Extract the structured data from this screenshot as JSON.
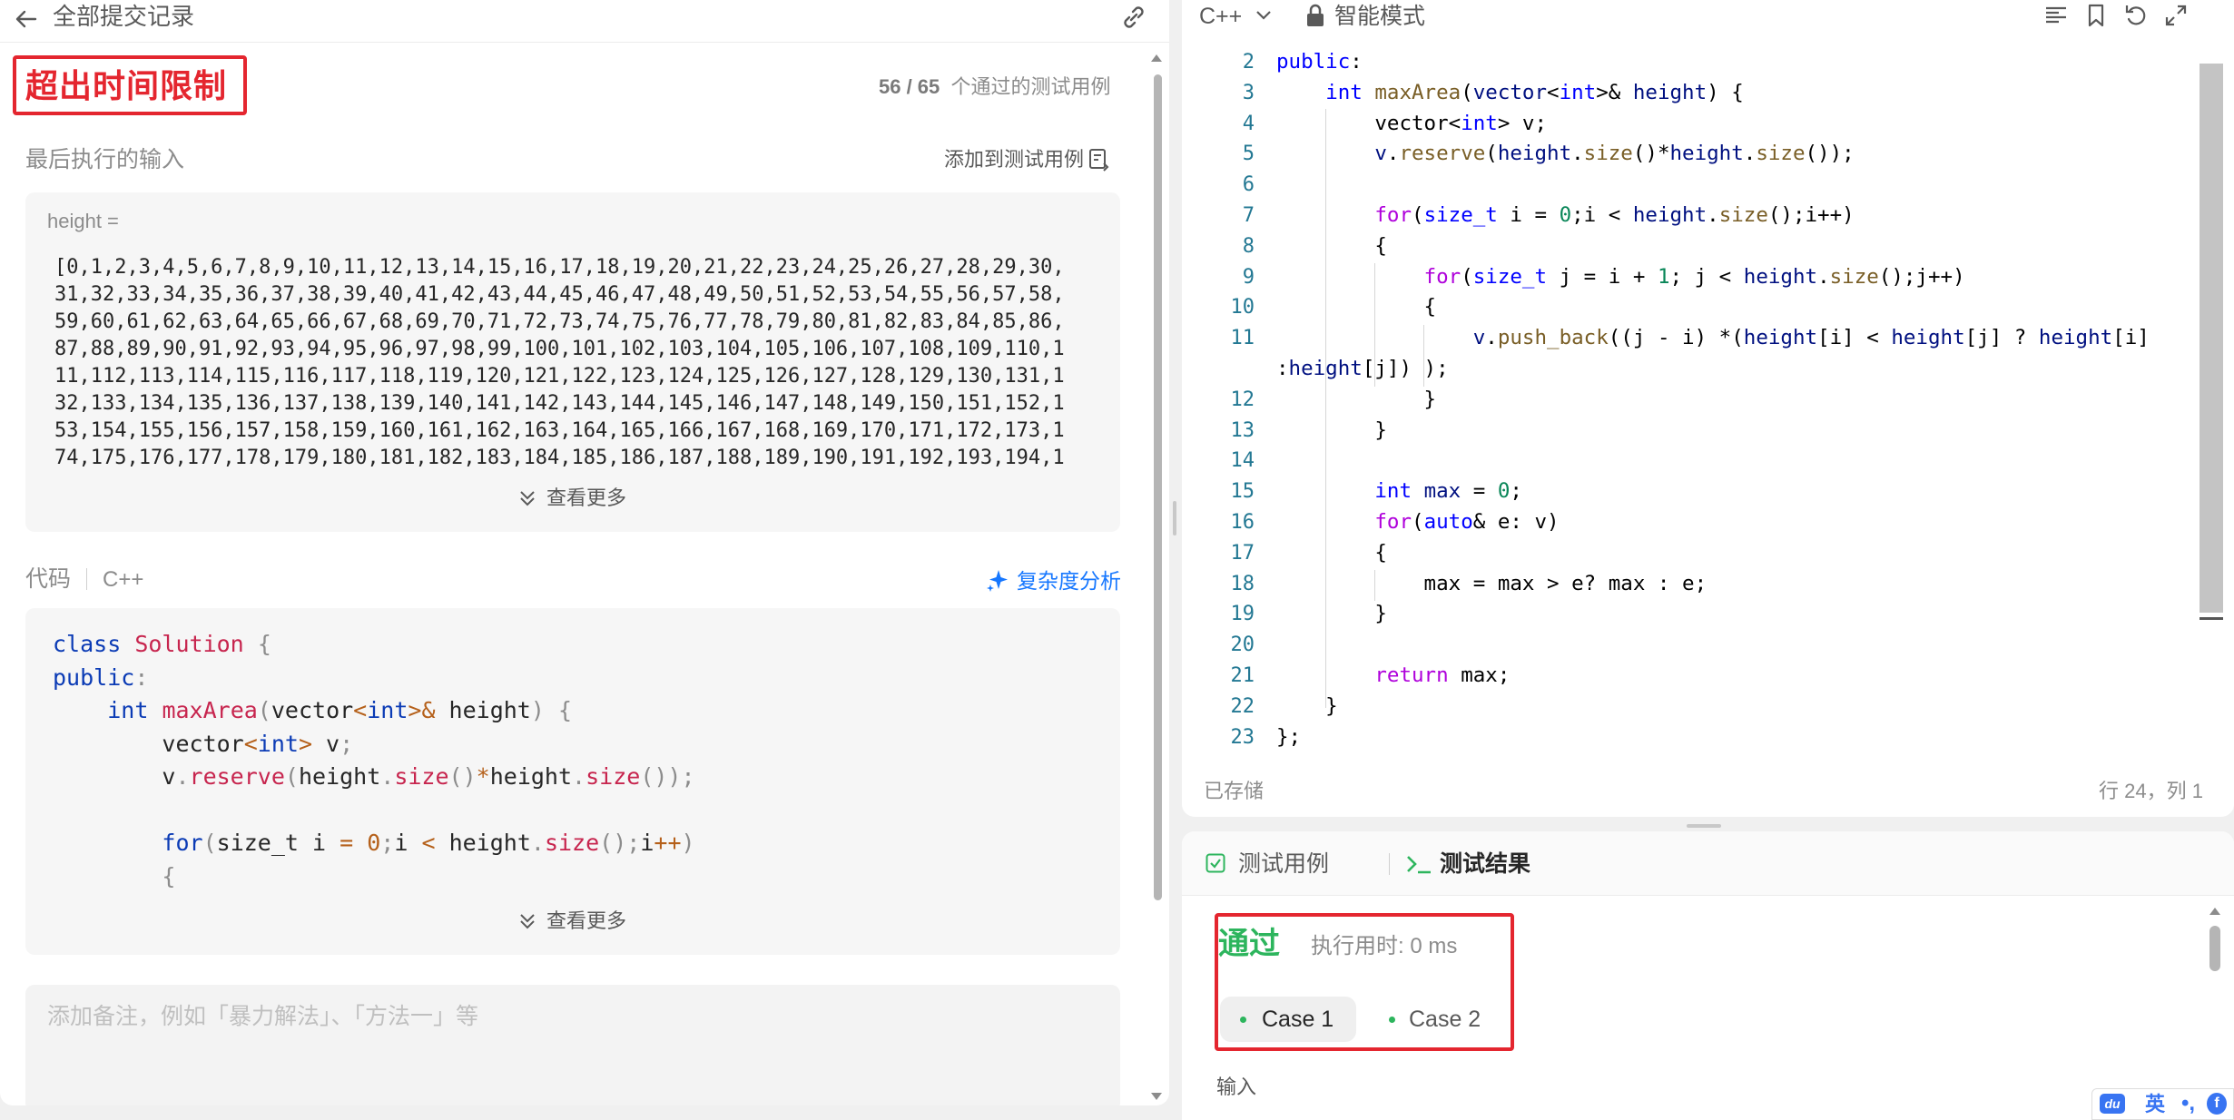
{
  "left_header": {
    "back_title": "全部提交记录"
  },
  "submission": {
    "status": "超出时间限制",
    "passed": "56 / 65",
    "passed_suffix": "个通过的测试用例"
  },
  "last_input": {
    "label": "最后执行的输入",
    "add_to_testcase": "添加到测试用例",
    "param_name": "height =",
    "param_value_lines": [
      "[0,1,2,3,4,5,6,7,8,9,10,11,12,13,14,15,16,17,18,19,20,21,22,23,24,25,26,27,28,29,30,",
      "31,32,33,34,35,36,37,38,39,40,41,42,43,44,45,46,47,48,49,50,51,52,53,54,55,56,57,58,",
      "59,60,61,62,63,64,65,66,67,68,69,70,71,72,73,74,75,76,77,78,79,80,81,82,83,84,85,86,",
      "87,88,89,90,91,92,93,94,95,96,97,98,99,100,101,102,103,104,105,106,107,108,109,110,1",
      "11,112,113,114,115,116,117,118,119,120,121,122,123,124,125,126,127,128,129,130,131,1",
      "32,133,134,135,136,137,138,139,140,141,142,143,144,145,146,147,148,149,150,151,152,1",
      "53,154,155,156,157,158,159,160,161,162,163,164,165,166,167,168,169,170,171,172,173,1",
      "74,175,176,177,178,179,180,181,182,183,184,185,186,187,188,189,190,191,192,193,194,1"
    ],
    "see_more": "查看更多"
  },
  "code_section": {
    "label": "代码",
    "language": "C++",
    "complexity": "复杂度分析",
    "see_more": "查看更多"
  },
  "note": {
    "placeholder": "添加备注，例如「暴力解法」、「方法一」等"
  },
  "editor": {
    "language": "C++",
    "mode": "智能模式",
    "saved": "已存储",
    "cursor": "行 24，列 1",
    "line_numbers": [
      "2",
      "3",
      "4",
      "5",
      "6",
      "7",
      "8",
      "9",
      "10",
      "11",
      "",
      "12",
      "13",
      "14",
      "15",
      "16",
      "17",
      "18",
      "19",
      "20",
      "21",
      "22",
      "23"
    ]
  },
  "result": {
    "tab_testcase": "测试用例",
    "tab_result": "测试结果",
    "verdict": "通过",
    "runtime": "执行用时: 0 ms",
    "cases": [
      "Case 1",
      "Case 2"
    ],
    "input_label": "输入"
  },
  "ime": {
    "logo": "du",
    "lang": "英",
    "punct": "•,"
  },
  "colors": {
    "error": "#e4262f",
    "success": "#2db55d",
    "link": "#1677ff"
  }
}
